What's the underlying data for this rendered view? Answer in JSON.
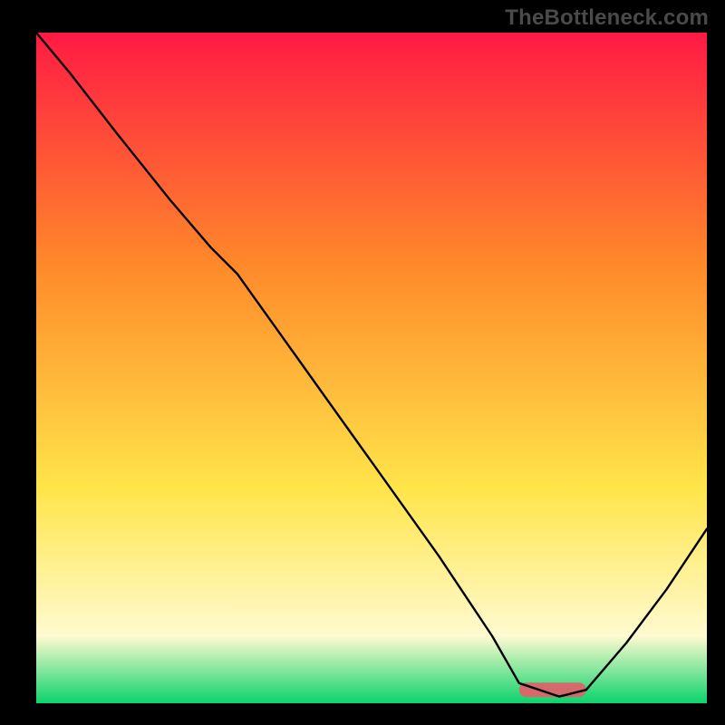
{
  "watermark": "TheBottleneck.com",
  "chart_data": {
    "type": "line",
    "title": "",
    "xlabel": "",
    "ylabel": "",
    "xlim": [
      0,
      100
    ],
    "ylim": [
      0,
      100
    ],
    "grid": false,
    "legend": false,
    "background_gradient": {
      "top": "#ff1a44",
      "mid1": "#ff8a2a",
      "mid2": "#ffe54a",
      "near_bottom": "#fffad0",
      "bottom": "#0bd36b"
    },
    "optimal_marker": {
      "x_start": 72,
      "x_end": 82,
      "y": 2,
      "color": "#d46a6a"
    },
    "series": [
      {
        "name": "curve",
        "color": "#000000",
        "x": [
          0,
          5,
          12,
          20,
          26,
          30,
          40,
          50,
          60,
          68,
          72,
          78,
          82,
          88,
          94,
          100
        ],
        "y": [
          100,
          94,
          85,
          75,
          68,
          64,
          50,
          36,
          22,
          10,
          3,
          1,
          2,
          9,
          17,
          26
        ]
      }
    ]
  }
}
